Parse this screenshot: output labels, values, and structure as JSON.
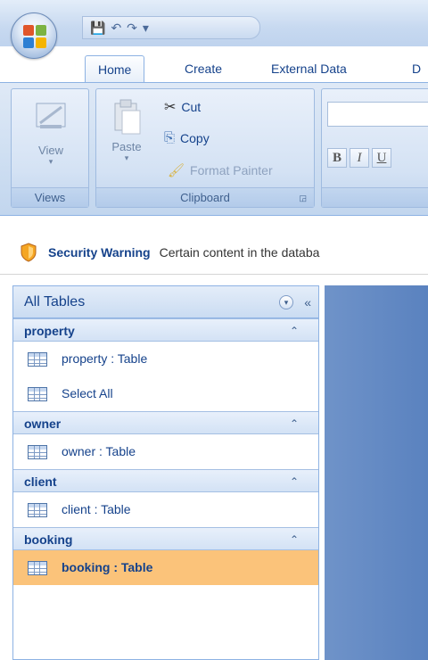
{
  "ribbon_tabs": [
    "Home",
    "Create",
    "External Data",
    "D"
  ],
  "views_group": {
    "view_label": "View",
    "group_label": "Views"
  },
  "clipboard_group": {
    "paste_label": "Paste",
    "cut_label": "Cut",
    "copy_label": "Copy",
    "format_painter_label": "Format Painter",
    "group_label": "Clipboard"
  },
  "font_buttons": [
    "B",
    "I",
    "U"
  ],
  "security_bar": {
    "title": "Security Warning",
    "message": "Certain content in the databa"
  },
  "nav_pane": {
    "header": "All Tables",
    "groups": [
      {
        "name": "property",
        "items": [
          "property : Table",
          "Select All"
        ]
      },
      {
        "name": "owner",
        "items": [
          "owner : Table"
        ]
      },
      {
        "name": "client",
        "items": [
          "client : Table"
        ]
      },
      {
        "name": "booking",
        "items": [
          "booking : Table"
        ]
      }
    ]
  },
  "colors": {
    "selected_item": "#fbc37a",
    "accent": "#15428b",
    "work_area": "#6f93c9"
  },
  "icons": [
    "office-button-icon",
    "save-icon",
    "undo-icon",
    "redo-icon",
    "customize-qat-icon",
    "shield-icon",
    "table-icon",
    "select-all-icon",
    "collapse-icon",
    "shutter-bar-icon",
    "dialog-launcher-icon",
    "cut-icon",
    "copy-icon",
    "format-painter-icon",
    "paste-icon",
    "view-icon"
  ]
}
